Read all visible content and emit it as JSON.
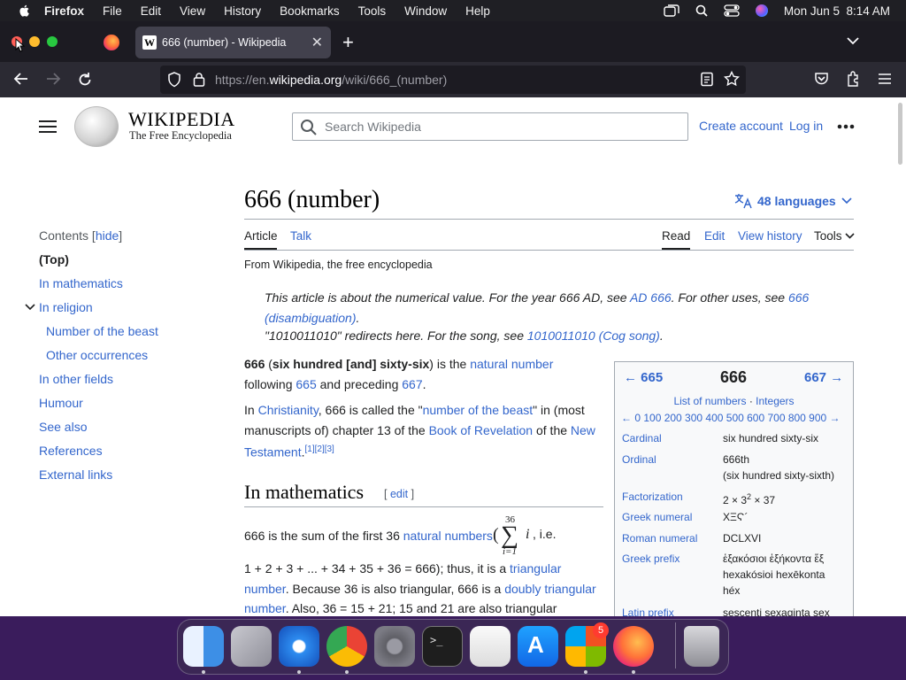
{
  "menubar": {
    "app": "Firefox",
    "items": [
      "File",
      "Edit",
      "View",
      "History",
      "Bookmarks",
      "Tools",
      "Window",
      "Help"
    ],
    "datetime": "Mon Jun 5  8:14 AM"
  },
  "browser": {
    "tab_title": "666 (number) - Wikipedia",
    "url_prefix": "https://en.",
    "url_domain": "wikipedia.org",
    "url_path": "/wiki/666_(number)"
  },
  "wiki": {
    "logo_title": "WIKIPEDIA",
    "logo_subtitle": "The Free Encyclopedia",
    "search_placeholder": "Search Wikipedia",
    "create_account": "Create account",
    "log_in": "Log in",
    "page_title": "666 (number)",
    "languages": "48 languages",
    "tabs": {
      "article": "Article",
      "talk": "Talk",
      "read": "Read",
      "edit": "Edit",
      "history": "View history",
      "tools": "Tools"
    },
    "from": "From Wikipedia, the free encyclopedia",
    "hatnote1_a": "This article is about the numerical value. For the year 666 AD, see ",
    "hatnote1_link1": "AD 666",
    "hatnote1_b": ". For other uses, see ",
    "hatnote1_link2a": "666",
    "hatnote1_link2b": "(disambiguation)",
    "hatnote1_c": ".",
    "hatnote2_a": "\"1010011010\" redirects here. For the song, see ",
    "hatnote2_link": "1010011010 (Cog song)",
    "hatnote2_b": "."
  },
  "toc": {
    "heading": "Contents",
    "hide": "hide",
    "items": [
      "(Top)",
      "In mathematics",
      "In religion",
      "Number of the beast",
      "Other occurrences",
      "In other fields",
      "Humour",
      "See also",
      "References",
      "External links"
    ]
  },
  "intro": {
    "p1_bold1": "666",
    "p1_t1": " (",
    "p1_bold2": "six hundred [and] sixty-six",
    "p1_t2": ") is the ",
    "p1_link1": "natural number",
    "p1_t3": "following ",
    "p1_link2": "665",
    "p1_t4": " and preceding ",
    "p1_link3": "667",
    "p1_t5": ".",
    "p2_t1": "In ",
    "p2_link1": "Christianity",
    "p2_t2": ", 666 is called the \"",
    "p2_link2": "number of the beast",
    "p2_t3": "\" in (most",
    "p2_t4": "manuscripts of) chapter 13 of the ",
    "p2_link3": "Book of Revelation",
    "p2_t5": " of the ",
    "p2_link4a": "New",
    "p2_link4b": "Testament",
    "p2_t6": ".",
    "p2_refs": "[1][2][3]"
  },
  "math": {
    "heading": "In mathematics",
    "edit": "edit",
    "p1_t1": "666 is the sum of the first 36 ",
    "p1_link": "natural numbers",
    "p1_t2": "i.e.",
    "sum_top": "36",
    "sum_bottom": "i=1",
    "sum_var": "i",
    "p2_t1": "1 + 2 + 3 + ... + 34 + 35 + 36 = 666); thus, it is a ",
    "p2_link1": "triangular",
    "p2_link1b": "number",
    "p2_t2": ". Because 36 is also triangular, 666 is a ",
    "p2_link2": "doubly triangular",
    "p2_link2b": "number",
    "p2_t3": ". Also, 36 = 15 + 21; 15 and 21 are also triangular"
  },
  "infobox": {
    "prev": "← 665",
    "current": "666",
    "next": "667 →",
    "list": "List of numbers",
    "integers": "Integers",
    "scale": "← 0 100 200 300 400 500 600 700 800 900 →",
    "rows": [
      {
        "label": "Cardinal",
        "value": "six hundred sixty-six"
      },
      {
        "label": "Ordinal",
        "value": "666th",
        "value2": "(six hundred sixty-sixth)"
      },
      {
        "label": "Factorization",
        "value": "2 × 3",
        "sup": "2",
        "value_tail": " × 37"
      },
      {
        "label": "Greek numeral",
        "value": "ΧΞϚ´"
      },
      {
        "label": "Roman numeral",
        "value": "DCLXVI"
      },
      {
        "label": "Greek prefix",
        "value": "ἑξακόσιοι ἑξήκοντα ἕξ",
        "value2": "hexakósioi hexēkonta",
        "value3": "héx"
      },
      {
        "label": "Latin prefix",
        "value": "sescenti sexaginta sex"
      }
    ]
  },
  "dock": {
    "mail_badge": "5"
  }
}
